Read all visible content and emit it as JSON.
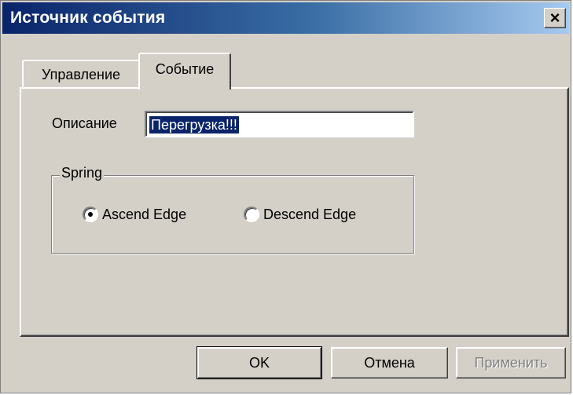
{
  "window": {
    "title": "Источник события",
    "close_symbol": "×"
  },
  "tabs": [
    {
      "label": "Управление",
      "active": false
    },
    {
      "label": "Событие",
      "active": true
    }
  ],
  "form": {
    "description_label": "Описание",
    "description_value": "Перегрузка!!!",
    "group_title": "Spring",
    "radio_options": [
      {
        "label": "Ascend Edge",
        "checked": true
      },
      {
        "label": "Descend Edge",
        "checked": false
      }
    ]
  },
  "buttons": {
    "ok": "OK",
    "cancel": "Отмена",
    "apply": "Применить",
    "apply_enabled": false
  },
  "colors": {
    "title_bar_start": "#0a246a",
    "title_bar_end": "#a6caf0",
    "face": "#d4d0c8",
    "selection": "#0a246a"
  }
}
